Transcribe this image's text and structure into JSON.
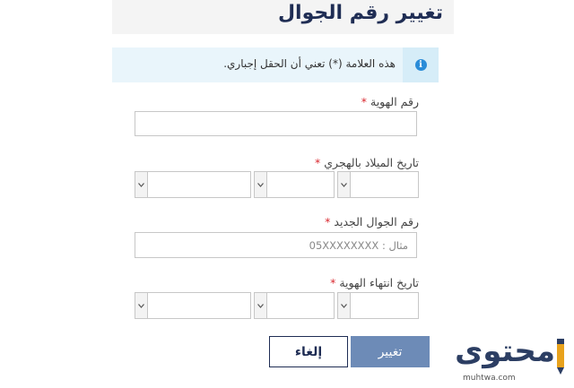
{
  "header": {
    "title": "تغيير رقم الجوال"
  },
  "notice": {
    "text": "هذه العلامة (*) تعني أن الحقل إجباري.",
    "icon": "info-icon",
    "icon_glyph": "i"
  },
  "form": {
    "id_number": {
      "label": "رقم الهوية",
      "required_mark": "*"
    },
    "hijri_birth_date": {
      "label": "تاريخ الميلاد بالهجري",
      "required_mark": "*"
    },
    "new_mobile": {
      "label": "رقم الجوال الجديد",
      "required_mark": "*",
      "placeholder": "مثال : 05XXXXXXXX"
    },
    "id_expiry_date": {
      "label": "تاريخ انتهاء الهوية",
      "required_mark": "*"
    }
  },
  "buttons": {
    "submit": "تغيير",
    "cancel": "إلغاء"
  },
  "logo": {
    "word": "محتوى",
    "site": "muhtwa.com"
  },
  "colors": {
    "title": "#1f2d54",
    "required": "#d9272e",
    "notice_bg": "#e9f5fb",
    "info_icon": "#2a8cd8",
    "submit_bg": "#6d8bb7"
  }
}
